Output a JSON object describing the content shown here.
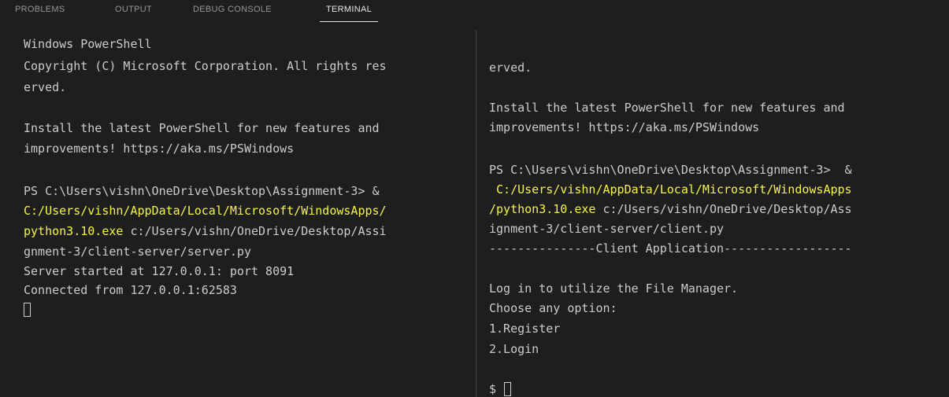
{
  "tabs": [
    "PROBLEMS",
    "OUTPUT",
    "DEBUG CONSOLE",
    "TERMINAL"
  ],
  "active_tab": "TERMINAL",
  "terminal_left": {
    "lines": [
      "Windows PowerShell",
      "Copyright (C) Microsoft Corporation. All rights res",
      "erved.",
      "Install the latest PowerShell for new features and",
      "improvements! https://aka.ms/PSWindows",
      "PS C:\\Users\\vishn\\OneDrive\\Desktop\\Assignment-3> &",
      "C:/Users/vishn/AppData/Local/Microsoft/WindowsApps/",
      "python3.10.exe",
      " c:/Users/vishn/OneDrive/Desktop/Assi",
      "gnment-3/client-server/server.py",
      "Server started at 127.0.0.1: port 8091",
      "Connected from 127.0.0.1:62583"
    ]
  },
  "terminal_right": {
    "lines": [
      "erved.",
      "Install the latest PowerShell for new features and",
      "improvements! https://aka.ms/PSWindows",
      "PS C:\\Users\\vishn\\OneDrive\\Desktop\\Assignment-3>  &",
      " C:/Users/vishn/AppData/Local/Microsoft/WindowsApps",
      "/python3.10.exe",
      " c:/Users/vishn/OneDrive/Desktop/Ass",
      "ignment-3/client-server/client.py",
      "---------------Client Application------------------",
      "Log in to utilize the File Manager.",
      "Choose any option:",
      "1.Register",
      "2.Login",
      "$ "
    ]
  },
  "colors": {
    "background": "#1e1e1e",
    "text": "#cccccc",
    "highlight_yellow": "#f5f543",
    "tab_inactive": "#969696",
    "tab_active": "#e7e7e7",
    "divider": "#444444"
  }
}
